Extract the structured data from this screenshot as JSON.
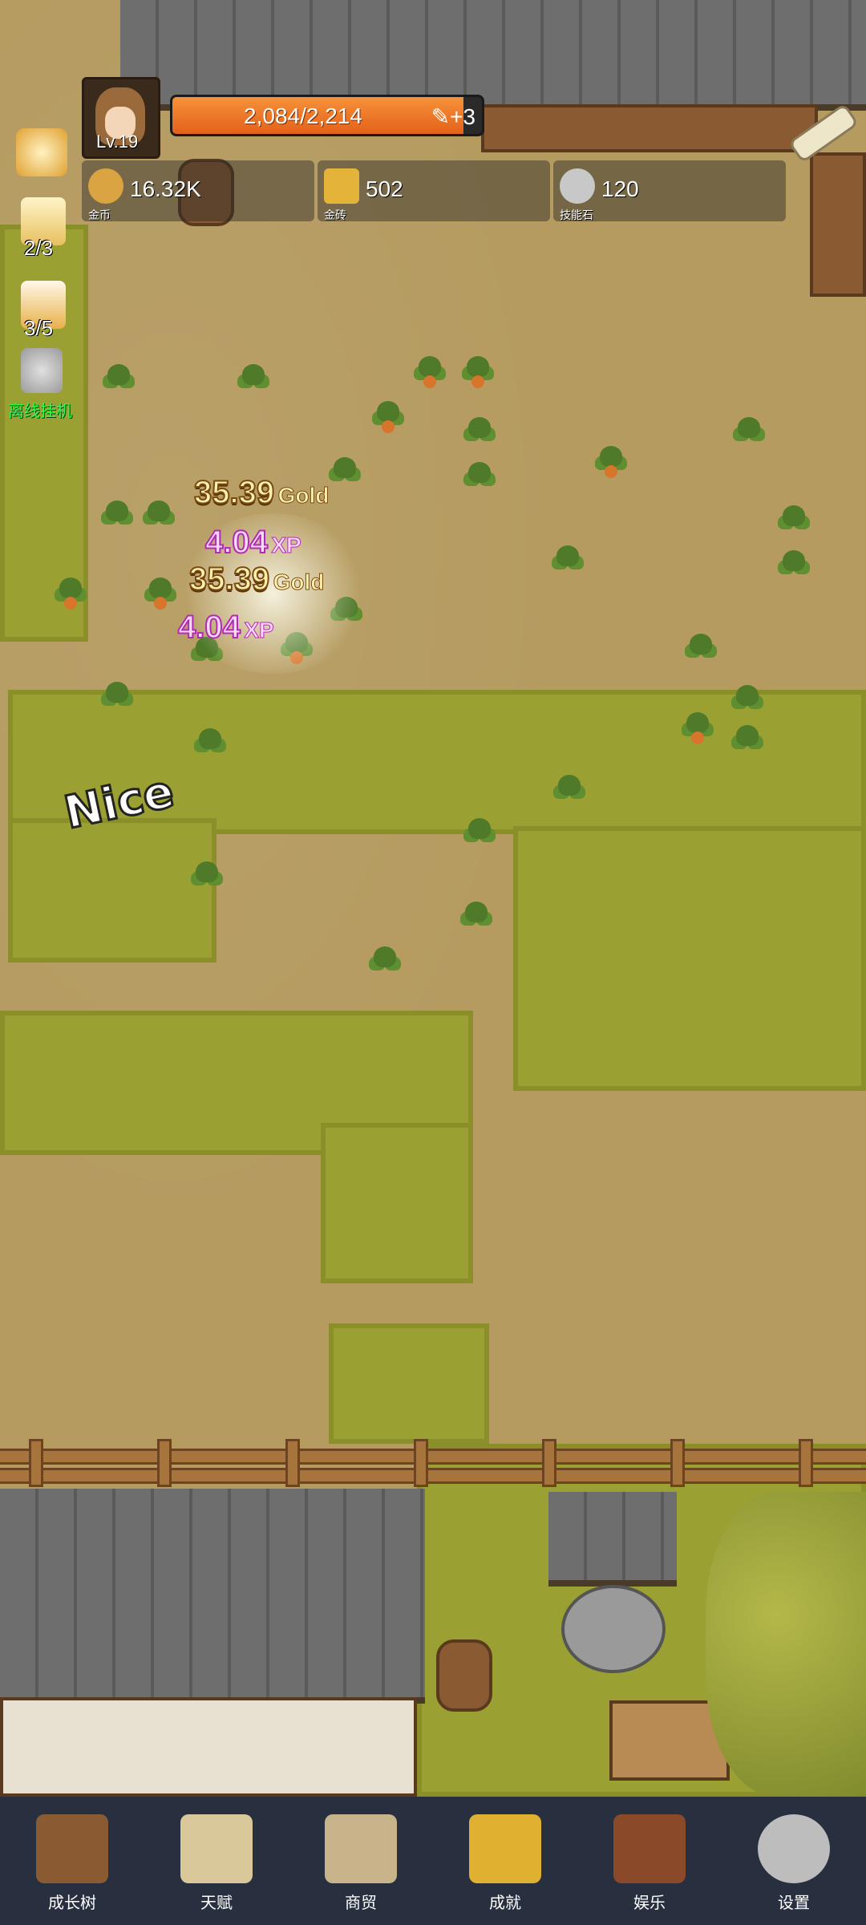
{
  "hud": {
    "level": "Lv.19",
    "xp_text": "2,084/2,214",
    "xp_fraction": 0.941,
    "xp_bonus": "+3",
    "resources": [
      {
        "value": "16.32K",
        "caption": "金币",
        "icon": "gold-coin-icon",
        "color": "#d9a441"
      },
      {
        "value": "502",
        "caption": "金砖",
        "icon": "gold-brick-icon",
        "color": "#e4b43a"
      },
      {
        "value": "120",
        "caption": "技能石",
        "icon": "skill-stone-icon",
        "color": "#c8c8c8"
      }
    ]
  },
  "side": {
    "candle_count": "2/3",
    "beer_count": "3/5",
    "afk_label": "离线挂机"
  },
  "floats": {
    "gold1": {
      "num": "35.39",
      "lbl": "Gold"
    },
    "xp1": {
      "num": "4.04",
      "lbl": "XP"
    },
    "gold2": {
      "num": "35.39",
      "lbl": "Gold"
    },
    "xp2": {
      "num": "4.04",
      "lbl": "XP"
    },
    "nice": "Nice"
  },
  "nav": [
    {
      "label": "成长树",
      "icon": "book-icon",
      "color": "#8a5a32"
    },
    {
      "label": "天赋",
      "icon": "scroll-icon",
      "color": "#d8c89a"
    },
    {
      "label": "商贸",
      "icon": "map-icon",
      "color": "#c8b48a"
    },
    {
      "label": "成就",
      "icon": "key-icon",
      "color": "#e0b030"
    },
    {
      "label": "娱乐",
      "icon": "banner-icon",
      "color": "#8a4a2a"
    },
    {
      "label": "设置",
      "icon": "gear-icon",
      "color": "#bdbdbd"
    }
  ]
}
